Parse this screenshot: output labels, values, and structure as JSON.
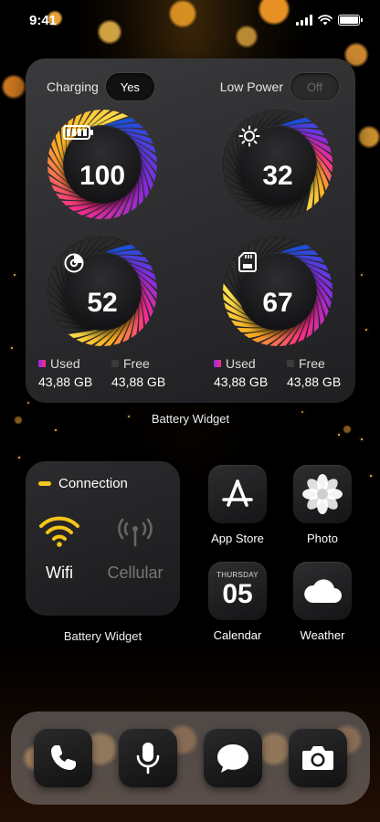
{
  "status_bar": {
    "time": "9:41"
  },
  "battery_widget": {
    "charging_label": "Charging",
    "charging_value": "Yes",
    "low_power_label": "Low Power",
    "low_power_value": "Off",
    "gauges": [
      {
        "icon": "battery-icon",
        "value": "100"
      },
      {
        "icon": "brightness-icon",
        "value": "32"
      },
      {
        "icon": "pie-chart-icon",
        "value": "52"
      },
      {
        "icon": "sd-card-icon",
        "value": "67"
      }
    ],
    "storage": [
      {
        "used_label": "Used",
        "used_value": "43,88 GB",
        "free_label": "Free",
        "free_value": "43,88 GB"
      },
      {
        "used_label": "Used",
        "used_value": "43,88 GB",
        "free_label": "Free",
        "free_value": "43,88 GB"
      }
    ],
    "caption": "Battery Widget"
  },
  "connection_widget": {
    "title": "Connection",
    "wifi_label": "Wifi",
    "cellular_label": "Cellular",
    "caption": "Battery Widget"
  },
  "apps": [
    {
      "name": "App Store",
      "icon": "app-store-icon"
    },
    {
      "name": "Photo",
      "icon": "photo-icon"
    },
    {
      "name": "Calendar",
      "icon": "calendar-icon",
      "day": "THURSDAY",
      "date": "05"
    },
    {
      "name": "Weather",
      "icon": "weather-icon"
    }
  ],
  "dock": [
    {
      "icon": "phone-icon"
    },
    {
      "icon": "microphone-icon"
    },
    {
      "icon": "message-icon"
    },
    {
      "icon": "camera-icon"
    }
  ],
  "colors": {
    "accent_yellow": "#f5c518",
    "gauge_gradient": [
      "#1e4fd8",
      "#8a2be2",
      "#ff2d8a",
      "#ffb020",
      "#ffe04a"
    ]
  }
}
